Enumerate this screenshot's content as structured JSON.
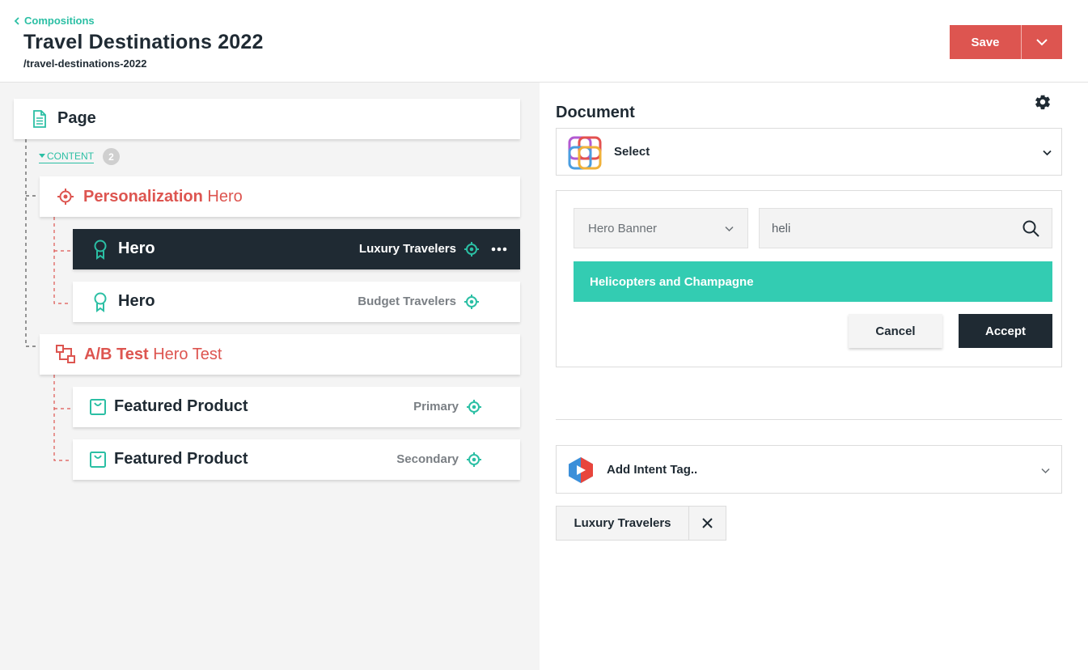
{
  "header": {
    "back_label": "Compositions",
    "title": "Travel Destinations 2022",
    "slug": "/travel-destinations-2022",
    "save_label": "Save"
  },
  "tree": {
    "page_label": "Page",
    "content_label": "CONTENT",
    "content_count": "2",
    "personalization": {
      "type": "Personalization",
      "name": "Hero"
    },
    "hero_items": [
      {
        "name": "Hero",
        "tag": "Luxury Travelers",
        "selected": true
      },
      {
        "name": "Hero",
        "tag": "Budget Travelers",
        "selected": false
      }
    ],
    "ab_test": {
      "type": "A/B Test",
      "name": "Hero Test"
    },
    "product_items": [
      {
        "name": "Featured Product",
        "tag": "Primary"
      },
      {
        "name": "Featured Product",
        "tag": "Secondary"
      }
    ]
  },
  "document": {
    "title": "Document",
    "select_label": "Select",
    "type_select_value": "Hero Banner",
    "search_value": "heli",
    "result_label": "Helicopters and Champagne",
    "cancel_label": "Cancel",
    "accept_label": "Accept"
  },
  "intent": {
    "select_label": "Add  Intent Tag..",
    "chips": [
      "Luxury Travelers"
    ]
  },
  "colors": {
    "accent_teal": "#2bbfa4",
    "brand_red": "#dd5550",
    "dark": "#1f2a33"
  }
}
